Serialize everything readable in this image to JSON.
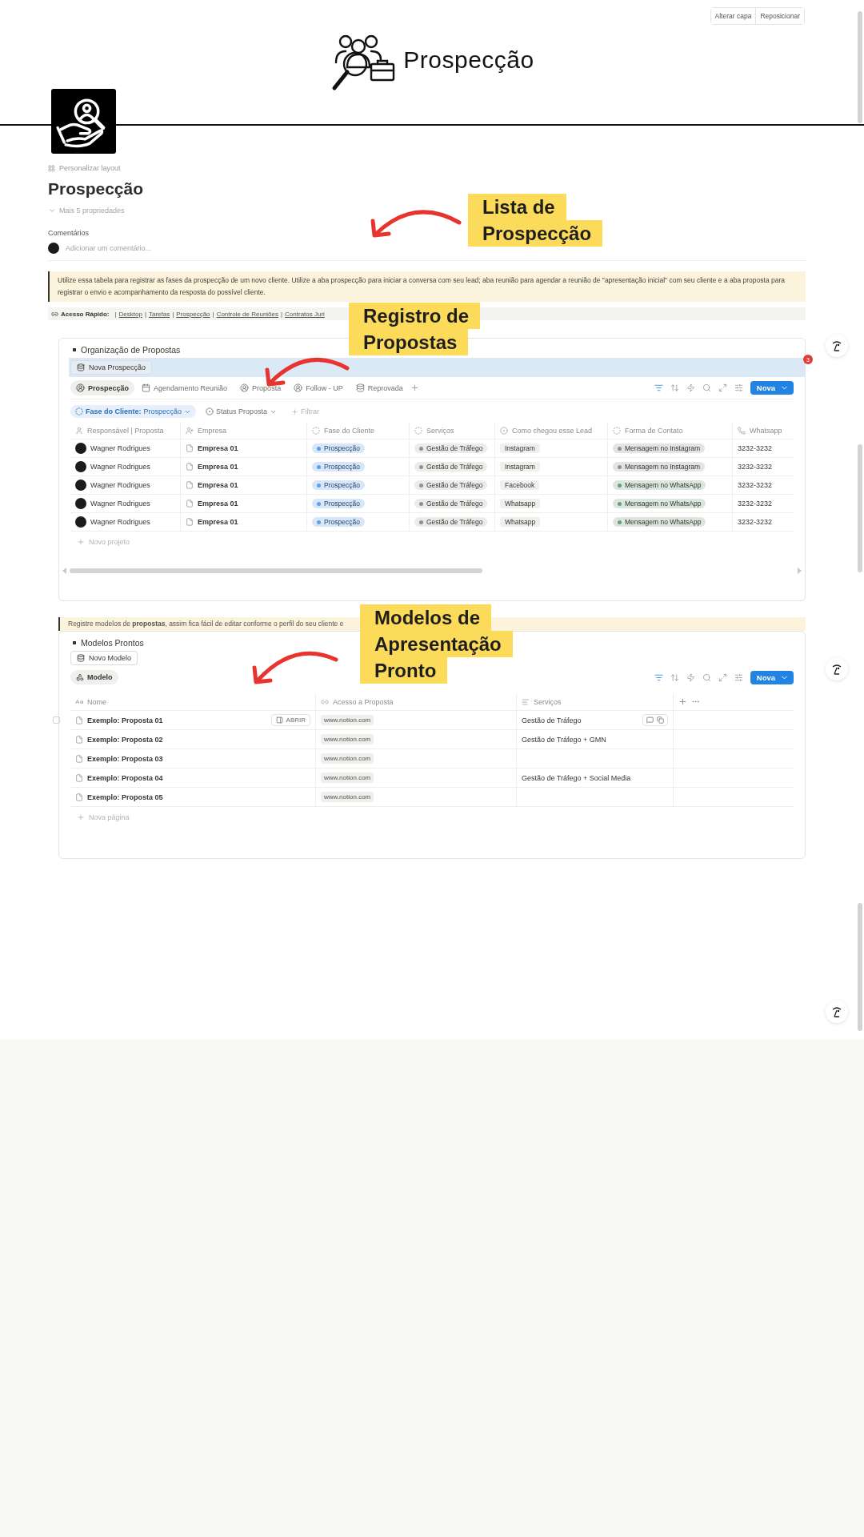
{
  "cover": {
    "title": "Prospecção",
    "buttons": [
      "Alterar capa",
      "Reposicionar"
    ]
  },
  "page": {
    "layout_button": "Personalizar layout",
    "title": "Prospecção",
    "more_properties": "Mais 5 propriedades",
    "comments_label": "Comentários",
    "comment_placeholder": "Adicionar um comentário..."
  },
  "note": "Utilize essa tabela para registrar as fases da prospecção de um novo cliente. Utilize a aba prospecção para iniciar a conversa com seu lead; aba reunião para agendar a reunião de \"apresentação inicial\" com seu cliente e a aba proposta para registrar o envio e acompanhamento da resposta do possível cliente.",
  "quick_access": {
    "label": "Acesso Rápido:",
    "separator": "|",
    "links": [
      "Desktop",
      "Tarefas",
      "Prospecção",
      "Controle de Reuniões",
      "Contratos Juri"
    ]
  },
  "annotations": [
    {
      "lines": [
        "Lista de",
        "Prospecção"
      ]
    },
    {
      "lines": [
        "Registro de",
        "Propostas"
      ]
    },
    {
      "lines": [
        "Modelos de",
        "Apresentação",
        "Pronto"
      ]
    }
  ],
  "proposals": {
    "title": "Organização de Propostas",
    "new_button": "Nova Prospecção",
    "badge": "3",
    "views": [
      {
        "label": "Prospecção",
        "kind": "person",
        "selected": true
      },
      {
        "label": "Agendamento Reunião",
        "kind": "calendar",
        "selected": false
      },
      {
        "label": "Proposta",
        "kind": "person",
        "selected": false
      },
      {
        "label": "Follow - UP",
        "kind": "person",
        "selected": false
      },
      {
        "label": "Reprovada",
        "kind": "database",
        "selected": false
      }
    ],
    "new_label": "Nova",
    "filters": [
      {
        "label": "Fase do Cliente:",
        "value": "Prospecção",
        "kind": "dashed",
        "active": true
      },
      {
        "label": "Status Proposta",
        "kind": "dot",
        "active": false
      }
    ],
    "add_filter": "Filtrar",
    "columns": [
      {
        "label": "Responsável | Proposta",
        "kind": "person"
      },
      {
        "label": "Empresa",
        "kind": "person-plus"
      },
      {
        "label": "Fase do Cliente",
        "kind": "dashed"
      },
      {
        "label": "Serviços",
        "kind": "dashed"
      },
      {
        "label": "Como chegou esse Lead",
        "kind": "dot"
      },
      {
        "label": "Forma de Contato",
        "kind": "dashed"
      },
      {
        "label": "Whatsapp",
        "kind": "phone"
      }
    ],
    "rows": [
      {
        "owner": "Wagner Rodrigues",
        "company": "Empresa 01",
        "phase": "Prospecção",
        "service": "Gestão de Tráfego",
        "lead": "Instagram",
        "contact": {
          "text": "Mensagem no Instagram",
          "color": "#91918e"
        },
        "whatsapp": "3232-3232"
      },
      {
        "owner": "Wagner Rodrigues",
        "company": "Empresa 01",
        "phase": "Prospecção",
        "service": "Gestão de Tráfego",
        "lead": "Instagram",
        "contact": {
          "text": "Mensagem no Instagram",
          "color": "#91918e"
        },
        "whatsapp": "3232-3232"
      },
      {
        "owner": "Wagner Rodrigues",
        "company": "Empresa 01",
        "phase": "Prospecção",
        "service": "Gestão de Tráfego",
        "lead": "Facebook",
        "contact": {
          "text": "Mensagem no WhatsApp",
          "color": "#6c9b7d"
        },
        "whatsapp": "3232-3232"
      },
      {
        "owner": "Wagner Rodrigues",
        "company": "Empresa 01",
        "phase": "Prospecção",
        "service": "Gestão de Tráfego",
        "lead": "Whatsapp",
        "contact": {
          "text": "Mensagem no WhatsApp",
          "color": "#6c9b7d"
        },
        "whatsapp": "3232-3232"
      },
      {
        "owner": "Wagner Rodrigues",
        "company": "Empresa 01",
        "phase": "Prospecção",
        "service": "Gestão de Tráfego",
        "lead": "Whatsapp",
        "contact": {
          "text": "Mensagem no WhatsApp",
          "color": "#6c9b7d"
        },
        "whatsapp": "3232-3232"
      }
    ],
    "add_row": "Novo projeto"
  },
  "note2": "Registre modelos de **propostas**, assim fica fácil de editar conforme o perfil do seu cliente e",
  "models": {
    "title": "Modelos Prontos",
    "new_button": "Novo Modelo",
    "view": {
      "label": "Modelo",
      "selected": true
    },
    "new_label": "Nova",
    "open_label": "ABRIR",
    "columns": [
      {
        "label": "Nome",
        "kind": "title"
      },
      {
        "label": "Acesso a Proposta",
        "kind": "link"
      },
      {
        "label": "Serviços",
        "kind": "text"
      }
    ],
    "rows": [
      {
        "name": "Exemplo: Proposta 01",
        "link": "www.notion.com",
        "services": "Gestão de Tráfego",
        "hovered": true
      },
      {
        "name": "Exemplo: Proposta 02",
        "link": "www.notion.com",
        "services": "Gestão de Tráfego + GMN",
        "hovered": false
      },
      {
        "name": "Exemplo: Proposta 03",
        "link": "www.notion.com",
        "hovered": false
      },
      {
        "name": "Exemplo: Proposta 04",
        "link": "www.notion.com",
        "services": "Gestão de Tráfego + Social Media",
        "hovered": false
      },
      {
        "name": "Exemplo: Proposta 05",
        "link": "www.notion.com",
        "hovered": false
      }
    ],
    "add_row": "Nova página"
  }
}
